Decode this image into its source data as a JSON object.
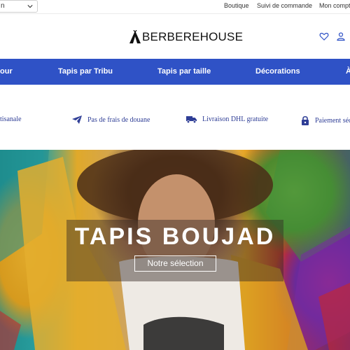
{
  "topbar": {
    "language_value": "n",
    "links": [
      "Boutique",
      "Suivi de commande",
      "Mon compte"
    ]
  },
  "header": {
    "logo_text": "BERBEREHOUSE",
    "icons": [
      "heart-icon",
      "user-icon",
      "cart-icon"
    ]
  },
  "nav": {
    "items": [
      "our",
      "Tapis par Tribu",
      "Tapis par taille",
      "Décorations",
      "À"
    ]
  },
  "features": [
    {
      "icon": "ribbon-icon",
      "label": "tisanale"
    },
    {
      "icon": "paper-plane-icon",
      "label": "Pas de frais de douane"
    },
    {
      "icon": "truck-icon",
      "label": "Livraison DHL gratuite"
    },
    {
      "icon": "lock-icon",
      "label": "Paiement séc"
    }
  ],
  "hero": {
    "title": "TAPIS BOUJAD",
    "button_label": "Notre sélection"
  },
  "colors": {
    "nav_background": "#2f52c6",
    "feature_text": "#2f3e96",
    "hero_text": "#ffffff"
  }
}
